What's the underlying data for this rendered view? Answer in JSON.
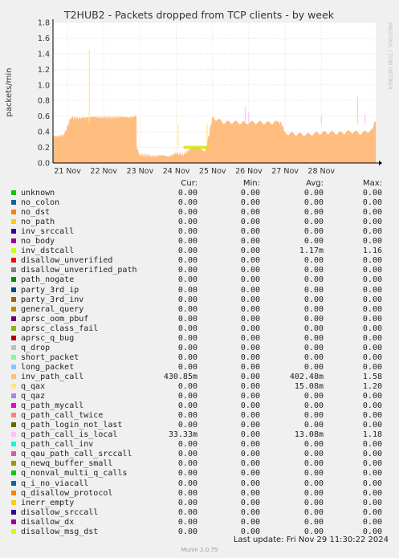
{
  "chart_data": {
    "type": "area",
    "title": "T2HUB2 - Packets dropped from TCP clients - by week",
    "ylabel": "packets/min",
    "ylim": [
      0,
      1.8
    ],
    "yticks": [
      0.0,
      0.2,
      0.4,
      0.6,
      0.8,
      1.0,
      1.2,
      1.4,
      1.6,
      1.8
    ],
    "xticks": [
      "21 Nov",
      "22 Nov",
      "23 Nov",
      "24 Nov",
      "25 Nov",
      "26 Nov",
      "27 Nov",
      "28 Nov"
    ],
    "grid": true,
    "watermark": "RRDTOOL / TOBI OETIKER",
    "series": [
      {
        "name": "inv_path_call",
        "color": "#ffbc7f",
        "segments": [
          {
            "x": [
              20.6,
              20.8,
              20.9,
              21.1,
              21.3,
              21.5,
              21.7,
              21.9,
              22.1,
              22.3,
              22.5,
              22.7,
              22.9
            ],
            "y": [
              0.34,
              0.34,
              0.35,
              0.58,
              0.57,
              0.58,
              0.59,
              0.58,
              0.58,
              0.58,
              0.59,
              0.58,
              0.6
            ]
          },
          {
            "x": [
              22.9,
              22.95,
              23.0,
              23.2,
              23.4,
              23.6,
              23.8
            ],
            "y": [
              0.22,
              0.13,
              0.1,
              0.09,
              0.08,
              0.1,
              0.08
            ]
          },
          {
            "x": [
              23.8,
              24.0,
              24.2,
              24.4,
              24.6,
              24.8
            ],
            "y": [
              0.08,
              0.12,
              0.1,
              0.18,
              0.2,
              0.14
            ]
          },
          {
            "x": [
              24.8,
              24.9,
              25.0,
              25.3,
              25.6,
              25.9,
              26.2,
              26.5,
              26.8,
              26.9,
              27.0,
              27.3,
              27.6,
              27.9,
              28.2,
              28.5,
              28.8,
              29.1,
              29.4,
              29.5
            ],
            "y": [
              0.14,
              0.35,
              0.58,
              0.52,
              0.52,
              0.51,
              0.52,
              0.51,
              0.52,
              0.5,
              0.38,
              0.37,
              0.36,
              0.38,
              0.39,
              0.38,
              0.4,
              0.38,
              0.42,
              0.55
            ]
          }
        ]
      },
      {
        "name": "q_path_call_is_local",
        "color": "#ffbffd",
        "spikes": [
          {
            "x": 25.9,
            "y": 0.72
          },
          {
            "x": 26.0,
            "y": 0.66
          },
          {
            "x": 28.0,
            "y": 0.6
          },
          {
            "x": 29.0,
            "y": 0.85
          },
          {
            "x": 29.2,
            "y": 0.62
          }
        ]
      },
      {
        "name": "q_qax",
        "color": "#ffe97f",
        "spikes": [
          {
            "x": 21.6,
            "y": 1.45
          },
          {
            "x": 24.85,
            "y": 0.26
          },
          {
            "x": 24.05,
            "y": 0.22
          }
        ]
      },
      {
        "name": "inv_dstcall",
        "color": "#d6e300",
        "band": {
          "x0": 24.2,
          "x1": 24.9,
          "y": 0.22
        }
      }
    ]
  },
  "legend": {
    "headers": {
      "cur": "Cur:",
      "min": "Min:",
      "avg": "Avg:",
      "max": "Max:"
    },
    "rows": [
      {
        "name": "unknown",
        "color": "#00cc00",
        "cur": "0.00",
        "min": "0.00",
        "avg": "0.00",
        "max": "0.00"
      },
      {
        "name": "no_colon",
        "color": "#0066b3",
        "cur": "0.00",
        "min": "0.00",
        "avg": "0.00",
        "max": "0.00"
      },
      {
        "name": "no_dst",
        "color": "#ff8000",
        "cur": "0.00",
        "min": "0.00",
        "avg": "0.00",
        "max": "0.00"
      },
      {
        "name": "no_path",
        "color": "#ffcc00",
        "cur": "0.00",
        "min": "0.00",
        "avg": "0.00",
        "max": "0.00"
      },
      {
        "name": "inv_srccall",
        "color": "#330099",
        "cur": "0.00",
        "min": "0.00",
        "avg": "0.00",
        "max": "0.00"
      },
      {
        "name": "no_body",
        "color": "#990099",
        "cur": "0.00",
        "min": "0.00",
        "avg": "0.00",
        "max": "0.00"
      },
      {
        "name": "inv_dstcall",
        "color": "#ccff00",
        "cur": "0.00",
        "min": "0.00",
        "avg": "1.17m",
        "max": "1.16"
      },
      {
        "name": "disallow_unverified",
        "color": "#ff0000",
        "cur": "0.00",
        "min": "0.00",
        "avg": "0.00",
        "max": "0.00"
      },
      {
        "name": "disallow_unverified_path",
        "color": "#808080",
        "cur": "0.00",
        "min": "0.00",
        "avg": "0.00",
        "max": "0.00"
      },
      {
        "name": "path_nogate",
        "color": "#008f00",
        "cur": "0.00",
        "min": "0.00",
        "avg": "0.00",
        "max": "0.00"
      },
      {
        "name": "party_3rd_ip",
        "color": "#00487d",
        "cur": "0.00",
        "min": "0.00",
        "avg": "0.00",
        "max": "0.00"
      },
      {
        "name": "party_3rd_inv",
        "color": "#b35a00",
        "cur": "0.00",
        "min": "0.00",
        "avg": "0.00",
        "max": "0.00"
      },
      {
        "name": "general_query",
        "color": "#b38f00",
        "cur": "0.00",
        "min": "0.00",
        "avg": "0.00",
        "max": "0.00"
      },
      {
        "name": "aprsc_oom_pbuf",
        "color": "#6b006b",
        "cur": "0.00",
        "min": "0.00",
        "avg": "0.00",
        "max": "0.00"
      },
      {
        "name": "aprsc_class_fail",
        "color": "#8fb300",
        "cur": "0.00",
        "min": "0.00",
        "avg": "0.00",
        "max": "0.00"
      },
      {
        "name": "aprsc_q_bug",
        "color": "#b30000",
        "cur": "0.00",
        "min": "0.00",
        "avg": "0.00",
        "max": "0.00"
      },
      {
        "name": "q_drop",
        "color": "#bebebe",
        "cur": "0.00",
        "min": "0.00",
        "avg": "0.00",
        "max": "0.00"
      },
      {
        "name": "short_packet",
        "color": "#80ff80",
        "cur": "0.00",
        "min": "0.00",
        "avg": "0.00",
        "max": "0.00"
      },
      {
        "name": "long_packet",
        "color": "#80c9ff",
        "cur": "0.00",
        "min": "0.00",
        "avg": "0.00",
        "max": "0.00"
      },
      {
        "name": "inv_path_call",
        "color": "#ffc080",
        "cur": "430.85m",
        "min": "0.00",
        "avg": "402.48m",
        "max": "1.58"
      },
      {
        "name": "q_qax",
        "color": "#ffe680",
        "cur": "0.00",
        "min": "0.00",
        "avg": "15.08m",
        "max": "1.20"
      },
      {
        "name": "q_qaz",
        "color": "#aa80ff",
        "cur": "0.00",
        "min": "0.00",
        "avg": "0.00",
        "max": "0.00"
      },
      {
        "name": "q_path_mycall",
        "color": "#ee00cc",
        "cur": "0.00",
        "min": "0.00",
        "avg": "0.00",
        "max": "0.00"
      },
      {
        "name": "q_path_call_twice",
        "color": "#ff8080",
        "cur": "0.00",
        "min": "0.00",
        "avg": "0.00",
        "max": "0.00"
      },
      {
        "name": "q_path_login_not_last",
        "color": "#666600",
        "cur": "0.00",
        "min": "0.00",
        "avg": "0.00",
        "max": "0.00"
      },
      {
        "name": "q_path_call_is_local",
        "color": "#ffbfff",
        "cur": "33.33m",
        "min": "0.00",
        "avg": "13.08m",
        "max": "1.18"
      },
      {
        "name": "q_path_call_inv",
        "color": "#00ffcc",
        "cur": "0.00",
        "min": "0.00",
        "avg": "0.00",
        "max": "0.00"
      },
      {
        "name": "q_qau_path_call_srccall",
        "color": "#cc6699",
        "cur": "0.00",
        "min": "0.00",
        "avg": "0.00",
        "max": "0.00"
      },
      {
        "name": "q_newq_buffer_small",
        "color": "#999900",
        "cur": "0.00",
        "min": "0.00",
        "avg": "0.00",
        "max": "0.00"
      },
      {
        "name": "q_nonval_multi_q_calls",
        "color": "#00cc00",
        "cur": "0.00",
        "min": "0.00",
        "avg": "0.00",
        "max": "0.00"
      },
      {
        "name": "q_i_no_viacall",
        "color": "#0066b3",
        "cur": "0.00",
        "min": "0.00",
        "avg": "0.00",
        "max": "0.00"
      },
      {
        "name": "q_disallow_protocol",
        "color": "#ff8000",
        "cur": "0.00",
        "min": "0.00",
        "avg": "0.00",
        "max": "0.00"
      },
      {
        "name": "inerr_empty",
        "color": "#ffcc00",
        "cur": "0.00",
        "min": "0.00",
        "avg": "0.00",
        "max": "0.00"
      },
      {
        "name": "disallow_srccall",
        "color": "#330099",
        "cur": "0.00",
        "min": "0.00",
        "avg": "0.00",
        "max": "0.00"
      },
      {
        "name": "disallow_dx",
        "color": "#990099",
        "cur": "0.00",
        "min": "0.00",
        "avg": "0.00",
        "max": "0.00"
      },
      {
        "name": "disallow_msg_dst",
        "color": "#ccff00",
        "cur": "0.00",
        "min": "0.00",
        "avg": "0.00",
        "max": "0.00"
      }
    ]
  },
  "footer": {
    "last_update": "Last update: Fri Nov 29 11:30:22 2024",
    "generator": "Munin 2.0.75"
  }
}
